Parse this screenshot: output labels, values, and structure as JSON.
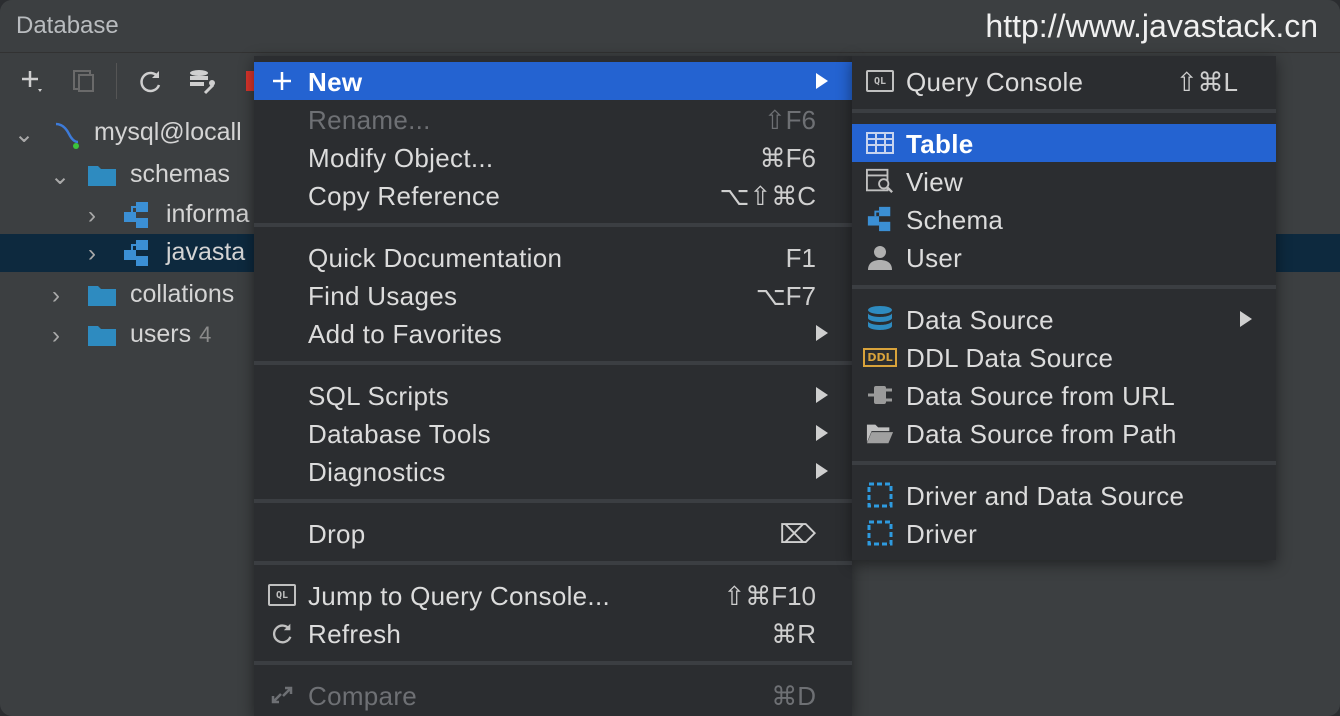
{
  "panel": {
    "title": "Database",
    "watermark": "http://www.javastack.cn"
  },
  "tree": {
    "root": "mysql@locall",
    "schemas": "schemas",
    "schema1": "informa",
    "schema2": "javasta",
    "collations": "collations",
    "users": "users",
    "users_count": "4"
  },
  "context_menu": {
    "new": "New",
    "rename": {
      "label": "Rename...",
      "shortcut": "⇧F6"
    },
    "modify": {
      "label": "Modify Object...",
      "shortcut": "⌘F6"
    },
    "copy_ref": {
      "label": "Copy Reference",
      "shortcut": "⌥⇧⌘C"
    },
    "quick_doc": {
      "label": "Quick Documentation",
      "shortcut": "F1"
    },
    "find_usages": {
      "label": "Find Usages",
      "shortcut": "⌥F7"
    },
    "favorites": {
      "label": "Add to Favorites"
    },
    "sql_scripts": {
      "label": "SQL Scripts"
    },
    "db_tools": {
      "label": "Database Tools"
    },
    "diagnostics": {
      "label": "Diagnostics"
    },
    "drop": {
      "label": "Drop",
      "shortcut": "⌦"
    },
    "jump_console": {
      "label": "Jump to Query Console...",
      "shortcut": "⇧⌘F10"
    },
    "refresh": {
      "label": "Refresh",
      "shortcut": "⌘R"
    },
    "compare": {
      "label": "Compare",
      "shortcut": "⌘D"
    }
  },
  "submenu": {
    "query_console": {
      "label": "Query Console",
      "shortcut": "⇧⌘L"
    },
    "table": "Table",
    "view": "View",
    "schema": "Schema",
    "user": "User",
    "data_source": "Data Source",
    "ddl_data_source": "DDL Data Source",
    "ds_url": "Data Source from URL",
    "ds_path": "Data Source from Path",
    "driver_ds": "Driver and Data Source",
    "driver": "Driver",
    "ddl_badge": "DDL",
    "ql_badge": "QL"
  },
  "colors": {
    "highlight": "#2463d1",
    "selection": "#0d293e",
    "folder": "#2e8bc0"
  }
}
